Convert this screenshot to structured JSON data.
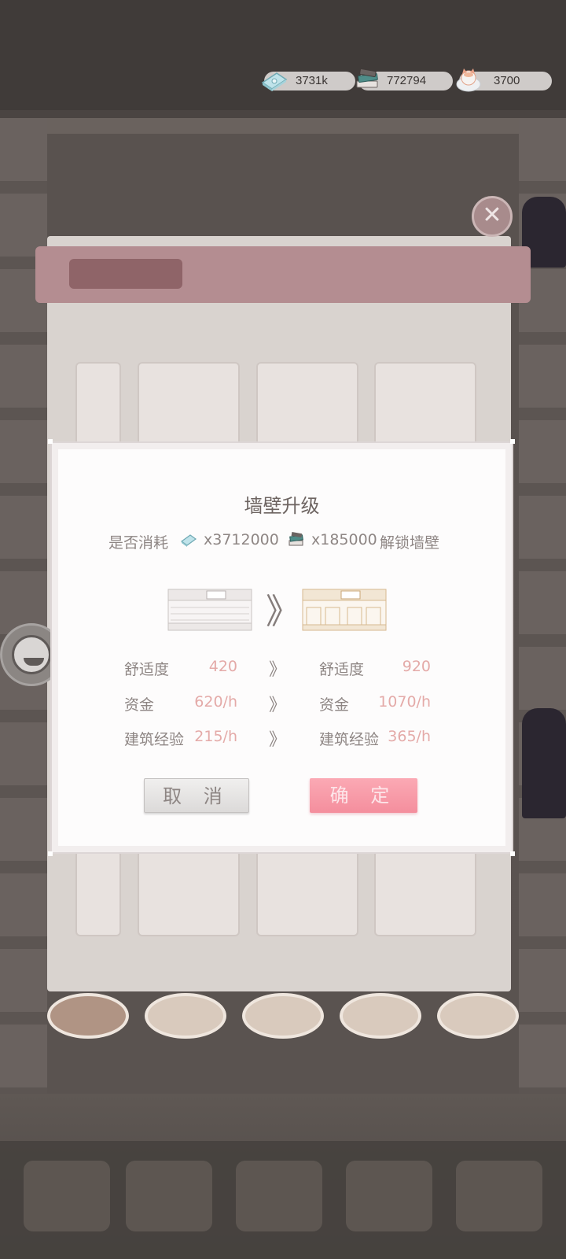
{
  "resources": {
    "cash": "3731k",
    "books": "772794",
    "cats": "3700"
  },
  "dialog": {
    "title": "墙壁升级",
    "cost_prefix": "是否消耗",
    "cost_cash": "x3712000",
    "cost_books": "x185000",
    "cost_suffix": "解锁墙壁",
    "stats": [
      {
        "label": "舒适度",
        "before": "420",
        "after": "920"
      },
      {
        "label": "资金",
        "before": "620/h",
        "after": "1070/h"
      },
      {
        "label": "建筑经验",
        "before": "215/h",
        "after": "365/h"
      }
    ],
    "arrow": "》",
    "big_arrow": "》",
    "cancel_label": "取 消",
    "confirm_label": "确 定"
  },
  "colors": {
    "confirm": "#f48e9d",
    "value_pink": "#e4aaa8",
    "text_gray": "#8e8684"
  },
  "icons": {
    "cash": "cash-stack-icon",
    "books": "book-stack-icon",
    "cats": "cat-icon",
    "close": "close-icon",
    "mascot": "mascot-icon"
  }
}
